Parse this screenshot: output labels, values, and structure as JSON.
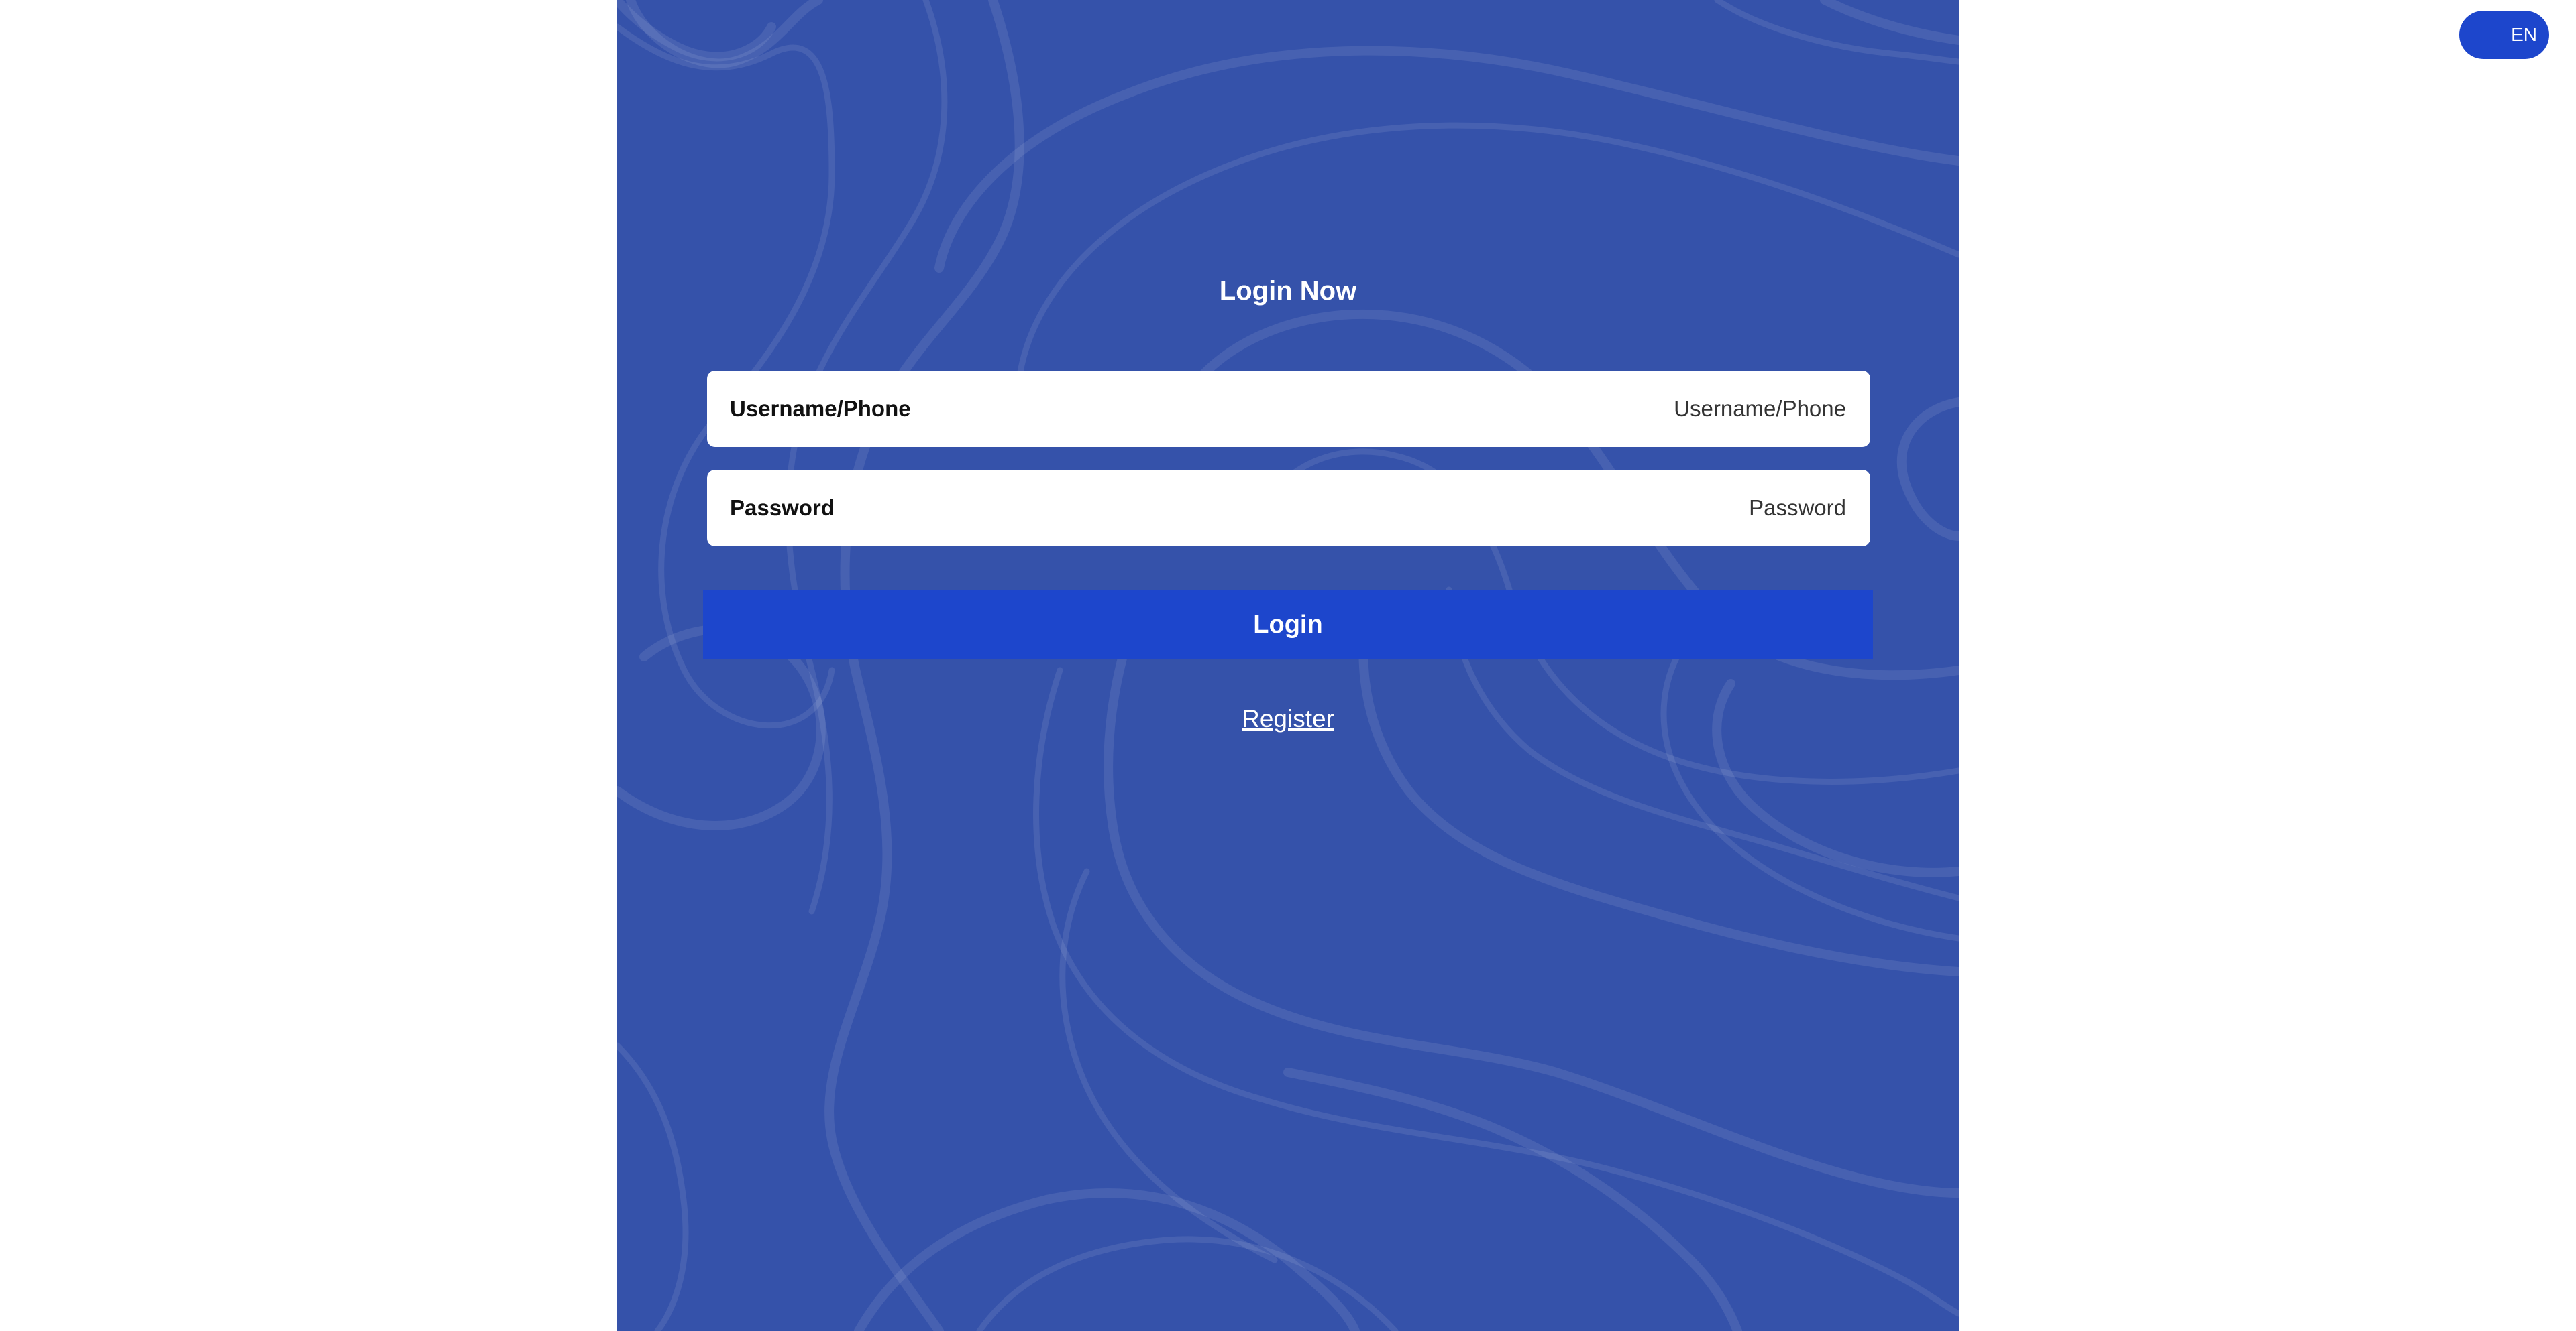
{
  "language_toggle": {
    "label": "EN"
  },
  "login_form": {
    "title": "Login Now",
    "username": {
      "label": "Username/Phone",
      "placeholder": "Username/Phone",
      "value": ""
    },
    "password": {
      "label": "Password",
      "placeholder": "Password",
      "value": ""
    },
    "submit_label": "Login",
    "register_label": "Register"
  },
  "colors": {
    "page_background": "#ffffff",
    "panel_background": "#3552aa",
    "accent": "#1d46cc",
    "field_background": "#ffffff"
  },
  "icons": {
    "background_pattern": "topographic-contour-lines"
  }
}
